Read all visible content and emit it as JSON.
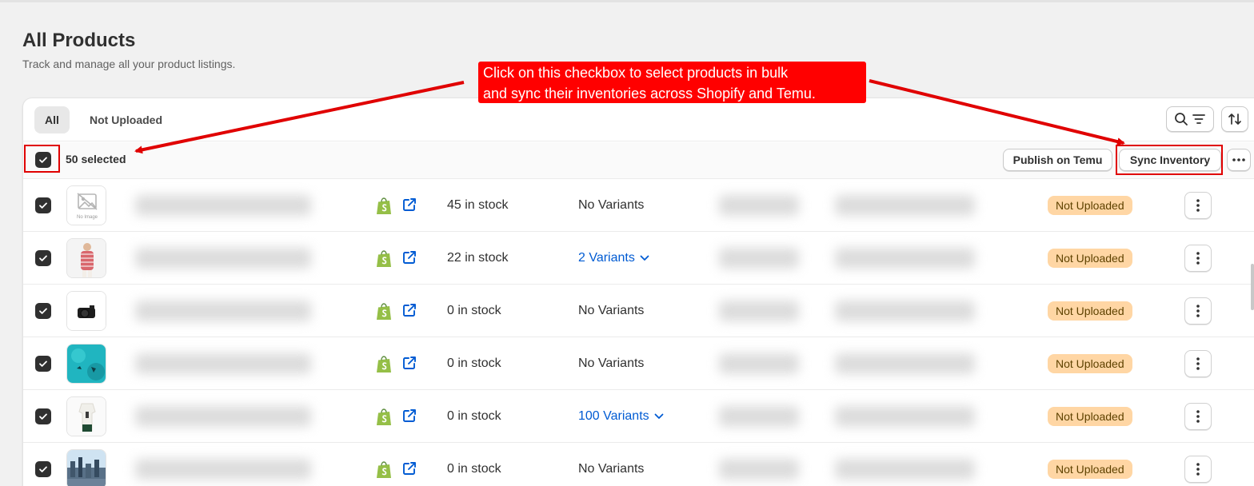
{
  "header": {
    "title": "All Products",
    "subtitle": "Track and manage all your product listings."
  },
  "tabs": [
    {
      "label": "All",
      "active": true
    },
    {
      "label": "Not Uploaded",
      "active": false
    }
  ],
  "toolbar": {
    "search_filter_icon": "search-filter-icon",
    "sort_icon": "sort-icon"
  },
  "bulk_actions": {
    "selected_count": "50 selected",
    "publish_label": "Publish on Temu",
    "sync_label": "Sync Inventory",
    "more_icon": "ellipsis-icon"
  },
  "products": [
    {
      "stock": "45 in stock",
      "variants": "No Variants",
      "variants_link": false,
      "status": "Not Uploaded",
      "thumb": "no-image"
    },
    {
      "stock": "22 in stock",
      "variants": "2 Variants",
      "variants_link": true,
      "status": "Not Uploaded",
      "thumb": "person"
    },
    {
      "stock": "0 in stock",
      "variants": "No Variants",
      "variants_link": false,
      "status": "Not Uploaded",
      "thumb": "camera"
    },
    {
      "stock": "0 in stock",
      "variants": "No Variants",
      "variants_link": false,
      "status": "Not Uploaded",
      "thumb": "ocean"
    },
    {
      "stock": "0 in stock",
      "variants": "100 Variants",
      "variants_link": true,
      "status": "Not Uploaded",
      "thumb": "shirt"
    },
    {
      "stock": "0 in stock",
      "variants": "No Variants",
      "variants_link": false,
      "status": "Not Uploaded",
      "thumb": "city"
    }
  ],
  "no_image_text": "No Image",
  "annotation": {
    "line1": "Click on this checkbox to select products in bulk",
    "line2": "and sync their inventories across Shopify and Temu."
  },
  "colors": {
    "badge_bg": "#ffd6a4",
    "link": "#005bd3",
    "shopify_green": "#95bf47",
    "annotation_red": "#ff0000"
  }
}
